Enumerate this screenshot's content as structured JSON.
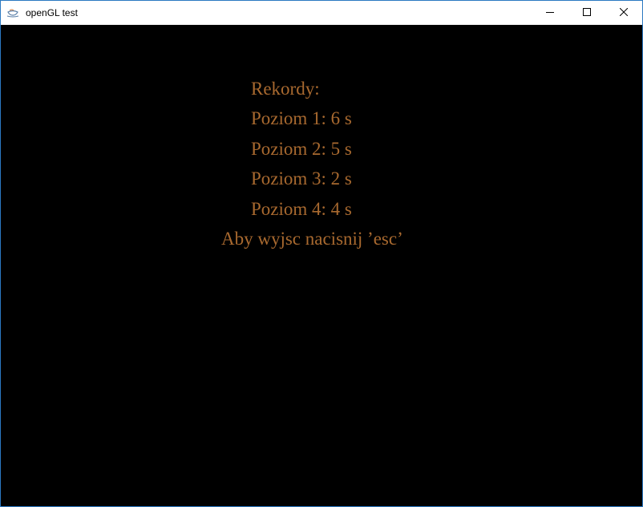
{
  "window": {
    "title": "openGL test",
    "icon": "java-cup-icon",
    "controls": [
      "minimize-icon",
      "maximize-icon",
      "close-icon"
    ]
  },
  "records": {
    "heading": "Rekordy:",
    "levels": [
      "Poziom 1: 6 s",
      "Poziom 2: 5 s",
      "Poziom 3: 2 s",
      "Poziom 4: 4 s"
    ],
    "exit_hint": "Aby wyjsc nacisnij ’esc’"
  },
  "colors": {
    "background": "#000000",
    "text": "#a8692f",
    "window_border": "#2b79c2"
  }
}
